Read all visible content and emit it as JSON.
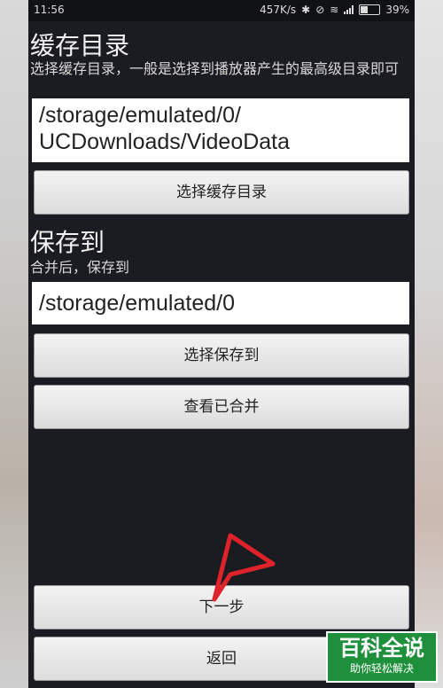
{
  "status_bar": {
    "time": "11:56",
    "speed": "457K/s",
    "battery": "39%",
    "battery_level": 0.39
  },
  "cache_section": {
    "title": "缓存目录",
    "description": "选择缓存目录，一般是选择到播放器产生的最高级目录即可",
    "path_line1": "/storage/emulated/0/",
    "path_line2": "UCDownloads/VideoData",
    "button": "选择缓存目录"
  },
  "save_section": {
    "title": "保存到",
    "description": "合并后，保存到",
    "path": "/storage/emulated/0",
    "button_choose": "选择保存到",
    "button_view": "查看已合并"
  },
  "footer": {
    "next_button": "下一步",
    "back_button": "返回"
  },
  "watermark": {
    "main": "百科全说",
    "sub": "助你轻松解决"
  },
  "colors": {
    "screen_bg": "#1b1c21",
    "annotation_arrow": "#e0232b",
    "watermark_bg": "#1e8f3b"
  }
}
